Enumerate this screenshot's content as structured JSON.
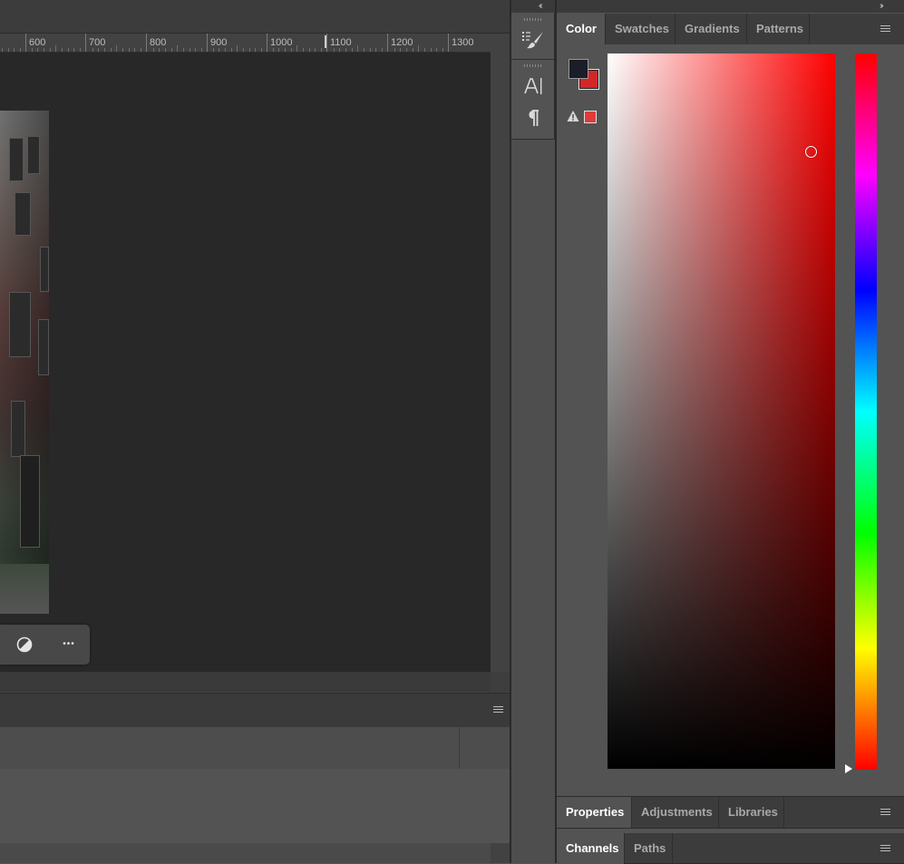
{
  "ruler": {
    "ticks": [
      "600",
      "700",
      "800",
      "900",
      "1000",
      "1100",
      "1200",
      "1300"
    ]
  },
  "panels": {
    "collapse_left_label": "‹‹",
    "collapse_right_label": "››",
    "color_group": {
      "tabs": [
        "Color",
        "Swatches",
        "Gradients",
        "Patterns"
      ],
      "active_tab": "Color"
    },
    "properties_group": {
      "tabs": [
        "Properties",
        "Adjustments",
        "Libraries"
      ],
      "active_tab": "Properties"
    },
    "channels_group": {
      "tabs": [
        "Channels",
        "Paths"
      ],
      "active_tab": "Channels"
    }
  },
  "color": {
    "foreground": "#1c1d2b",
    "background": "#d42626",
    "gamut_swatch": "#e03a3a",
    "hue_base": "#ff0000",
    "picker_saturation": 0.9,
    "picker_brightness": 0.86,
    "hue_position": 0.0
  },
  "tools": {
    "items": [
      "brush-presets-icon",
      "character-icon",
      "paragraph-icon"
    ]
  },
  "taskbar": {
    "more_label": "•••"
  },
  "accent": {
    "panel_bg": "#535353",
    "dark_bg": "#3c3c3c",
    "canvas_bg": "#282828"
  }
}
